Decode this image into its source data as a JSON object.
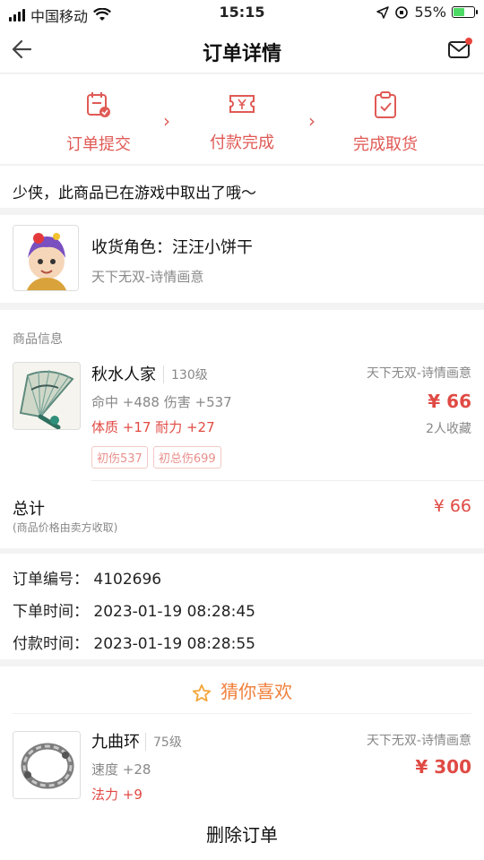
{
  "status_bar": {
    "carrier": "中国移动",
    "time": "15:15",
    "battery_percent": "55%",
    "battery_level": 0.55
  },
  "nav": {
    "title": "订单详情",
    "back_icon": "back-arrow-icon",
    "mail_icon": "mail-icon"
  },
  "steps": [
    {
      "label": "订单提交",
      "icon": "calendar-check-icon"
    },
    {
      "label": "付款完成",
      "icon": "ticket-yen-icon"
    },
    {
      "label": "完成取货",
      "icon": "clipboard-check-icon"
    }
  ],
  "tip": "少侠，此商品已在游戏中取出了哦～",
  "receiver": {
    "role": "收货角色：汪汪小饼干",
    "server": "天下无双-诗情画意"
  },
  "goods": {
    "section_label": "商品信息",
    "item": {
      "name": "秋水人家",
      "level": "130级",
      "attr1": "命中 +488 伤害 +537",
      "attr2": "体质 +17 耐力 +27",
      "tags": [
        "初伤537",
        "初总伤699"
      ],
      "server": "天下无双-诗情画意",
      "price": "¥ 66",
      "favorites": "2人收藏"
    },
    "total": {
      "label": "总计",
      "note": "(商品价格由卖方收取)",
      "price": "¥ 66"
    }
  },
  "order": {
    "number": "订单编号：  4102696",
    "created": "下单时间：  2023-01-19 08:28:45",
    "paid": "付款时间：  2023-01-19 08:28:55"
  },
  "guess": {
    "title": "猜你喜欢",
    "item": {
      "name": "九曲环",
      "level": "75级",
      "attr1": "速度 +28",
      "attr2": "法力 +9",
      "server": "天下无双-诗情画意",
      "price": "¥ 300"
    }
  },
  "delete_button": "删除订单",
  "colors": {
    "accent": "#e05a55",
    "price": "#e04a44",
    "guess": "#f07f3a"
  }
}
